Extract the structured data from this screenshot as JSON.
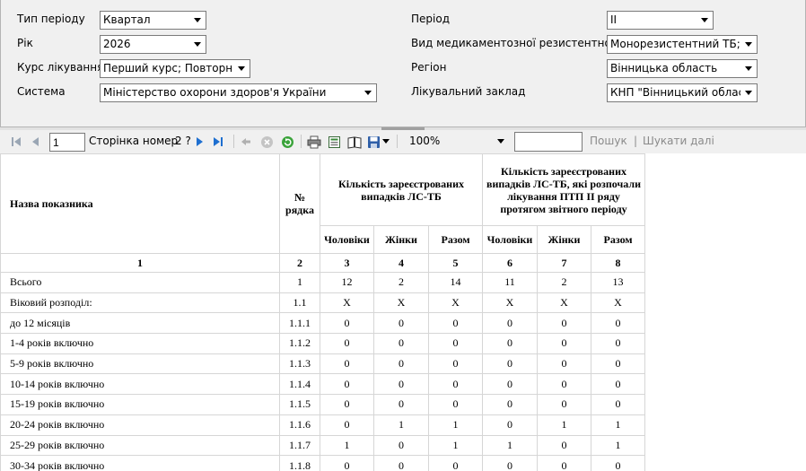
{
  "params": {
    "period_type": {
      "label": "Тип періоду",
      "value": "Квартал"
    },
    "year": {
      "label": "Рік",
      "value": "2026"
    },
    "course": {
      "label": "Курс лікування",
      "value": "Перший курс; Повторний"
    },
    "system": {
      "label": "Система",
      "value": "Міністерство охорони здоров'я України"
    },
    "period": {
      "label": "Період",
      "value": "II"
    },
    "resistance": {
      "label": "Вид медикаментозної резистентності",
      "value": "Монорезистентний ТБ; Ізон"
    },
    "region": {
      "label": "Регіон",
      "value": "Вінницька область"
    },
    "facility": {
      "label": "Лікувальний заклад",
      "value": "КНП \"Вінницький обласни"
    }
  },
  "toolbar": {
    "page_value": "1",
    "page_label": "Сторінка номер",
    "page_total": "2 ?",
    "zoom": "100%",
    "search_value": "",
    "find": "Пошук",
    "find_next": "Шукати далі",
    "find_sep": "|"
  },
  "table": {
    "headers": {
      "name": "Назва показника",
      "row_no": "№ рядка",
      "group1": "Кількість зареєстрованих випадків ЛС-ТБ",
      "group2": "Кількість зареєстрованих випадків ЛС-ТБ, які розпочали лікування ПТП ІІ ряду протягом звітного періоду",
      "men": "Чоловіки",
      "women": "Жінки",
      "total": "Разом"
    },
    "column_numbers": [
      "1",
      "2",
      "3",
      "4",
      "5",
      "6",
      "7",
      "8"
    ],
    "rows": [
      {
        "name": "Всього",
        "no": "1",
        "v": [
          "12",
          "2",
          "14",
          "11",
          "2",
          "13"
        ]
      },
      {
        "name": "Віковий розподіл:",
        "no": "1.1",
        "v": [
          "X",
          "X",
          "X",
          "X",
          "X",
          "X"
        ]
      },
      {
        "name": "до 12 місяців",
        "no": "1.1.1",
        "v": [
          "0",
          "0",
          "0",
          "0",
          "0",
          "0"
        ]
      },
      {
        "name": "1-4 років включно",
        "no": "1.1.2",
        "v": [
          "0",
          "0",
          "0",
          "0",
          "0",
          "0"
        ]
      },
      {
        "name": "5-9 років включно",
        "no": "1.1.3",
        "v": [
          "0",
          "0",
          "0",
          "0",
          "0",
          "0"
        ]
      },
      {
        "name": "10-14 років включно",
        "no": "1.1.4",
        "v": [
          "0",
          "0",
          "0",
          "0",
          "0",
          "0"
        ]
      },
      {
        "name": "15-19 років включно",
        "no": "1.1.5",
        "v": [
          "0",
          "0",
          "0",
          "0",
          "0",
          "0"
        ]
      },
      {
        "name": "20-24 років включно",
        "no": "1.1.6",
        "v": [
          "0",
          "1",
          "1",
          "0",
          "1",
          "1"
        ]
      },
      {
        "name": "25-29 років включно",
        "no": "1.1.7",
        "v": [
          "1",
          "0",
          "1",
          "1",
          "0",
          "1"
        ]
      },
      {
        "name": "30-34 років включно",
        "no": "1.1.8",
        "v": [
          "0",
          "0",
          "0",
          "0",
          "0",
          "0"
        ]
      }
    ]
  }
}
